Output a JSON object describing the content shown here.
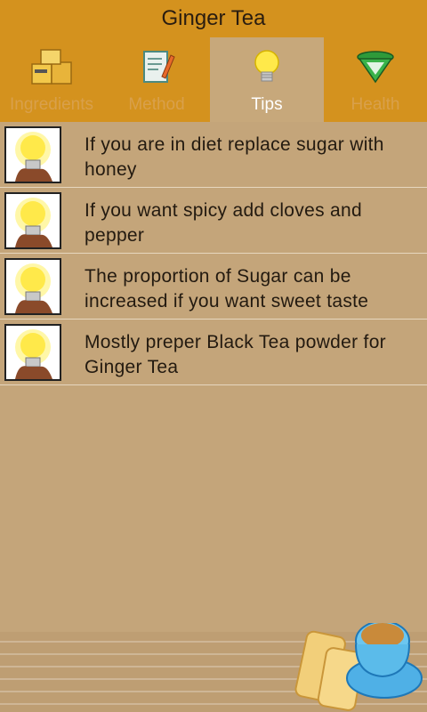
{
  "app": {
    "title": "Ginger Tea"
  },
  "tabs": [
    {
      "label": "Ingredients",
      "icon": "boxes-icon",
      "active": false
    },
    {
      "label": "Method",
      "icon": "notepad-icon",
      "active": false
    },
    {
      "label": "Tips",
      "icon": "lightbulb-icon",
      "active": true
    },
    {
      "label": "Health",
      "icon": "scale-icon",
      "active": false
    }
  ],
  "tips": [
    {
      "text": "If you are in diet replace sugar with honey",
      "icon": "lightbulb-icon"
    },
    {
      "text": "If you want spicy add cloves and pepper",
      "icon": "lightbulb-icon"
    },
    {
      "text": "The proportion of  Sugar can be increased if you want sweet taste",
      "icon": "lightbulb-icon"
    },
    {
      "text": "Mostly preper Black Tea powder for Ginger Tea",
      "icon": "lightbulb-icon"
    }
  ],
  "colors": {
    "header": "#d4921e",
    "background": "#c4a57a",
    "active_tab": "#c7a87b",
    "inactive_label": "#d9a04b"
  }
}
